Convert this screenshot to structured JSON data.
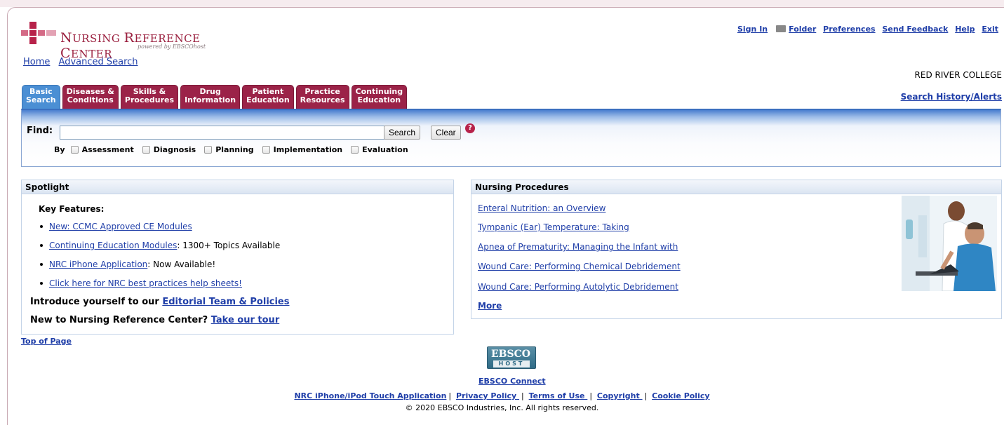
{
  "brand": {
    "name_prefix": "N",
    "name_rest": "URSING ",
    "name_prefix2": "R",
    "name_rest2": "EFERENCE ",
    "name_prefix3": "C",
    "name_rest3": "ENTER",
    "powered_by": "powered by EBSCOhost"
  },
  "nav": {
    "home": "Home",
    "advanced_search": "Advanced Search"
  },
  "toplinks": {
    "sign_in": "Sign In",
    "folder": "Folder",
    "preferences": "Preferences",
    "send_feedback": "Send Feedback",
    "help": "Help",
    "exit": "Exit"
  },
  "institution": "RED RIVER COLLEGE",
  "search_history": "Search History/Alerts",
  "tabs": [
    {
      "line1": "Basic",
      "line2": "Search"
    },
    {
      "line1": "Diseases &",
      "line2": "Conditions"
    },
    {
      "line1": "Skills &",
      "line2": "Procedures"
    },
    {
      "line1": "Drug",
      "line2": "Information"
    },
    {
      "line1": "Patient",
      "line2": "Education"
    },
    {
      "line1": "Practice",
      "line2": "Resources"
    },
    {
      "line1": "Continuing",
      "line2": "Education"
    }
  ],
  "search": {
    "find_label": "Find:",
    "value": "",
    "search_button": "Search",
    "clear_button": "Clear",
    "help_glyph": "?",
    "by_label": "By",
    "options": [
      "Assessment",
      "Diagnosis",
      "Planning",
      "Implementation",
      "Evaluation"
    ]
  },
  "spotlight": {
    "title": "Spotlight",
    "key_features": "Key Features:",
    "items": [
      {
        "link": "New: CCMC Approved CE Modules",
        "suffix": ""
      },
      {
        "link": "Continuing Education Modules",
        "suffix": ": 1300+ Topics Available"
      },
      {
        "link": "NRC iPhone Application",
        "suffix": ": Now Available!"
      },
      {
        "link": "Click here for NRC best practices help sheets!",
        "suffix": ""
      }
    ],
    "intro1_text": "Introduce yourself to our ",
    "intro1_link": "Editorial Team & Policies",
    "intro2_text": "New to Nursing Reference Center? ",
    "intro2_link": "Take our tour"
  },
  "procedures": {
    "title": "Nursing Procedures",
    "items": [
      "Enteral Nutrition: an Overview",
      "Tympanic (Ear) Temperature: Taking",
      "Apnea of Prematurity: Managing the Infant with",
      "Wound Care: Performing Chemical Debridement",
      "Wound Care: Performing Autolytic Debridement"
    ],
    "more": "More"
  },
  "top_of_page": "Top of Page",
  "footer": {
    "logo_top": "EBSCO",
    "logo_bottom": "HOST",
    "connect": "EBSCO Connect",
    "links": [
      "NRC iPhone/iPod Touch Application",
      "Privacy Policy ",
      "Terms of Use ",
      "Copyright ",
      "Cookie Policy"
    ],
    "copyright": "© 2020 EBSCO Industries, Inc. All rights reserved."
  },
  "colors": {
    "brand_red": "#9b2348",
    "active_tab_blue": "#4b8fd4",
    "link_blue": "#1f3ea8"
  }
}
